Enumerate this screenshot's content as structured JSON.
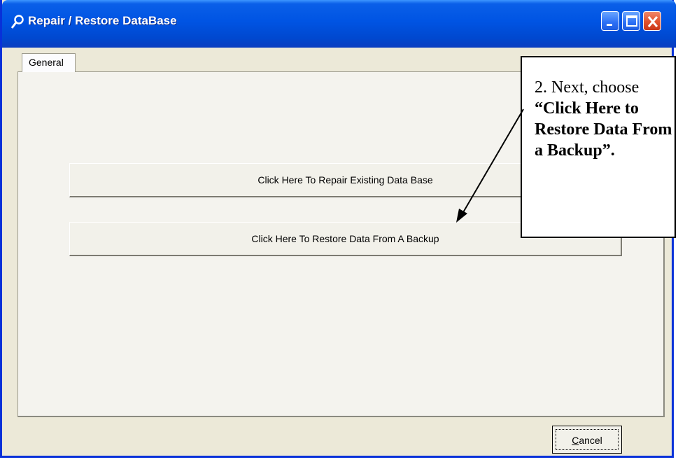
{
  "window": {
    "title": "Repair / Restore DataBase",
    "icon": "wrench-key-icon",
    "controls": [
      "minimize-icon",
      "maximize-icon",
      "close-icon"
    ]
  },
  "tabs": [
    {
      "label": "General"
    }
  ],
  "buttons": {
    "repair": "Click Here To Repair Existing Data Base",
    "restore": "Click Here To Restore Data From A Backup",
    "cancel_prefix": "C",
    "cancel_rest": "ancel"
  },
  "callout": {
    "lead": "2. Next, choose ",
    "emphasis": "“Click Here to Restore Data From a Backup”."
  },
  "colors": {
    "titlebar": "#0054e3",
    "face": "#ece9d8",
    "close": "#e0502c"
  }
}
